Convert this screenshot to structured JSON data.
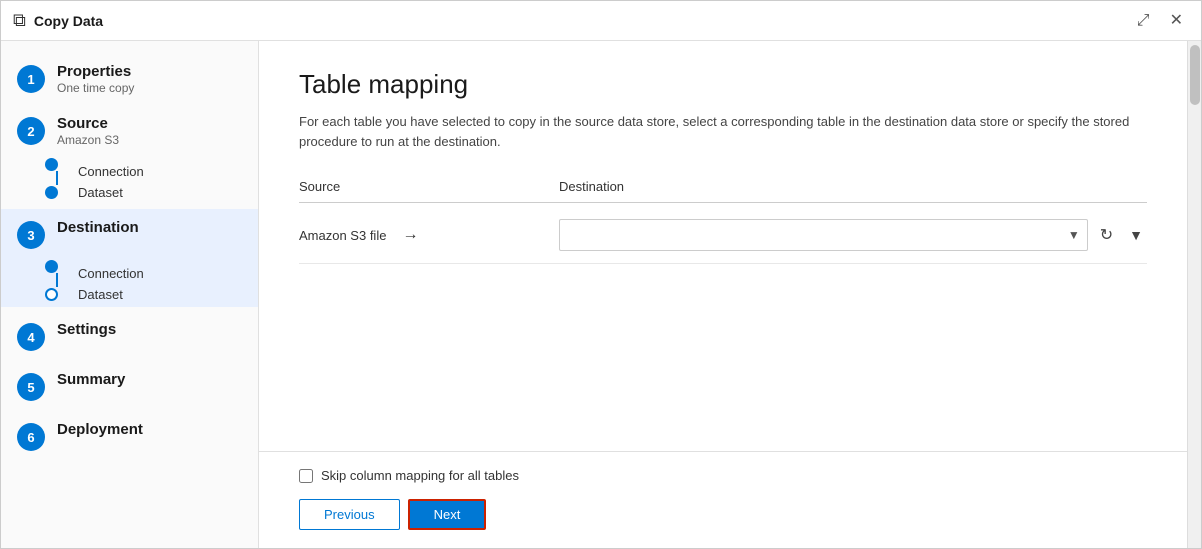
{
  "window": {
    "title": "Copy Data"
  },
  "sidebar": {
    "steps": [
      {
        "id": 1,
        "label": "Properties",
        "sublabel": "One time copy",
        "active": false,
        "sub_items": []
      },
      {
        "id": 2,
        "label": "Source",
        "sublabel": "Amazon S3",
        "active": false,
        "sub_items": [
          "Connection",
          "Dataset"
        ]
      },
      {
        "id": 3,
        "label": "Destination",
        "sublabel": "",
        "active": true,
        "sub_items": [
          "Connection",
          "Dataset"
        ]
      },
      {
        "id": 4,
        "label": "Settings",
        "sublabel": "",
        "active": false,
        "sub_items": []
      },
      {
        "id": 5,
        "label": "Summary",
        "sublabel": "",
        "active": false,
        "sub_items": []
      },
      {
        "id": 6,
        "label": "Deployment",
        "sublabel": "",
        "active": false,
        "sub_items": []
      }
    ]
  },
  "content": {
    "title": "Table mapping",
    "description": "For each table you have selected to copy in the source data store, select a corresponding table in the destination data store or specify the stored procedure to run at the destination.",
    "table_header_source": "Source",
    "table_header_dest": "Destination",
    "mapping_row": {
      "source": "Amazon S3 file",
      "dest_placeholder": ""
    },
    "skip_label": "Skip column mapping for all tables",
    "btn_previous": "Previous",
    "btn_next": "Next"
  }
}
